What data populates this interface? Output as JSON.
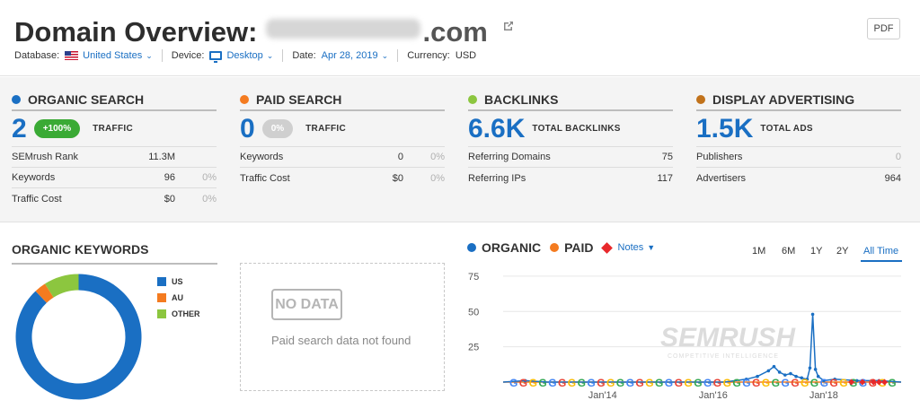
{
  "header": {
    "title_prefix": "Domain Overview:",
    "title_tld": ".com",
    "pdf_label": "PDF",
    "database_label": "Database:",
    "database_value": "United States",
    "device_label": "Device:",
    "device_value": "Desktop",
    "date_label": "Date:",
    "date_value": "Apr 28, 2019",
    "currency_label": "Currency:",
    "currency_value": "USD"
  },
  "cards": {
    "organic": {
      "title": "ORGANIC SEARCH",
      "color": "#1a6fc3",
      "big": "2",
      "badge": "+100%",
      "big_label": "TRAFFIC",
      "rows": [
        {
          "k": "SEMrush Rank",
          "v": "11.3M",
          "p": ""
        },
        {
          "k": "Keywords",
          "v": "96",
          "p": "0%"
        },
        {
          "k": "Traffic Cost",
          "v": "$0",
          "p": "0%"
        }
      ]
    },
    "paid": {
      "title": "PAID SEARCH",
      "color": "#f47b20",
      "big": "0",
      "badge": "0%",
      "big_label": "TRAFFIC",
      "rows": [
        {
          "k": "Keywords",
          "v": "0",
          "p": "0%"
        },
        {
          "k": "Traffic Cost",
          "v": "$0",
          "p": "0%"
        }
      ]
    },
    "backlinks": {
      "title": "BACKLINKS",
      "color": "#8cc63f",
      "big": "6.6K",
      "big_label": "TOTAL BACKLINKS",
      "rows": [
        {
          "k": "Referring Domains",
          "v": "75",
          "p": ""
        },
        {
          "k": "Referring IPs",
          "v": "117",
          "p": ""
        }
      ]
    },
    "display": {
      "title": "DISPLAY ADVERTISING",
      "color": "#c1721b",
      "big": "1.5K",
      "big_label": "TOTAL ADS",
      "rows": [
        {
          "k": "Publishers",
          "v": "0",
          "p": ""
        },
        {
          "k": "Advertisers",
          "v": "964",
          "p": ""
        }
      ]
    }
  },
  "organic_keywords": {
    "title": "ORGANIC KEYWORDS",
    "legend": [
      {
        "label": "US",
        "color": "#1a6fc3",
        "share": 0.88
      },
      {
        "label": "AU",
        "color": "#f47b20",
        "share": 0.03
      },
      {
        "label": "OTHER",
        "color": "#8cc63f",
        "share": 0.09
      }
    ]
  },
  "paid_no_data": {
    "badge": "NO DATA",
    "text": "Paid search data not found"
  },
  "traffic_chart": {
    "organic_label": "ORGANIC",
    "paid_label": "PAID",
    "notes_label": "Notes",
    "ranges": [
      "1M",
      "6M",
      "1Y",
      "2Y",
      "All Time"
    ],
    "active_range": "All Time",
    "watermark": "SEMRUSH",
    "watermark_sub": "COMPETITIVE INTELLIGENCE"
  },
  "chart_data": {
    "type": "line",
    "title": "",
    "xlabel": "",
    "ylabel": "",
    "ylim": [
      0,
      80
    ],
    "yticks": [
      25,
      50,
      75
    ],
    "xticks": [
      {
        "label": "Jan'14",
        "x": 2014.0
      },
      {
        "label": "Jan'16",
        "x": 2016.0
      },
      {
        "label": "Jan'18",
        "x": 2018.0
      }
    ],
    "xlim": [
      2012.2,
      2019.4
    ],
    "grid": true,
    "series": [
      {
        "name": "ORGANIC",
        "color": "#1a6fc3",
        "x": [
          2012.2,
          2012.6,
          2013.0,
          2013.4,
          2013.8,
          2014.2,
          2014.6,
          2015.0,
          2015.4,
          2015.8,
          2016.2,
          2016.6,
          2016.8,
          2017.0,
          2017.1,
          2017.2,
          2017.3,
          2017.4,
          2017.5,
          2017.6,
          2017.7,
          2017.75,
          2017.8,
          2017.85,
          2017.9,
          2018.0,
          2018.2,
          2018.6,
          2019.0,
          2019.4
        ],
        "y": [
          0,
          1,
          0,
          0,
          0,
          0,
          0,
          0,
          0,
          0,
          0,
          2,
          4,
          8,
          11,
          7,
          5,
          6,
          4,
          3,
          2,
          10,
          48,
          9,
          4,
          1,
          2,
          1,
          1,
          0
        ]
      },
      {
        "name": "PAID",
        "color": "#f47b20",
        "x": [
          2012.2,
          2013.0,
          2014.0,
          2015.0,
          2016.0,
          2017.0,
          2018.0,
          2019.4
        ],
        "y": [
          0,
          0,
          0,
          0,
          0,
          0,
          0,
          0
        ]
      }
    ],
    "notes_markers_x": [
      2018.5,
      2018.7,
      2018.9,
      2019.0,
      2019.1
    ]
  }
}
